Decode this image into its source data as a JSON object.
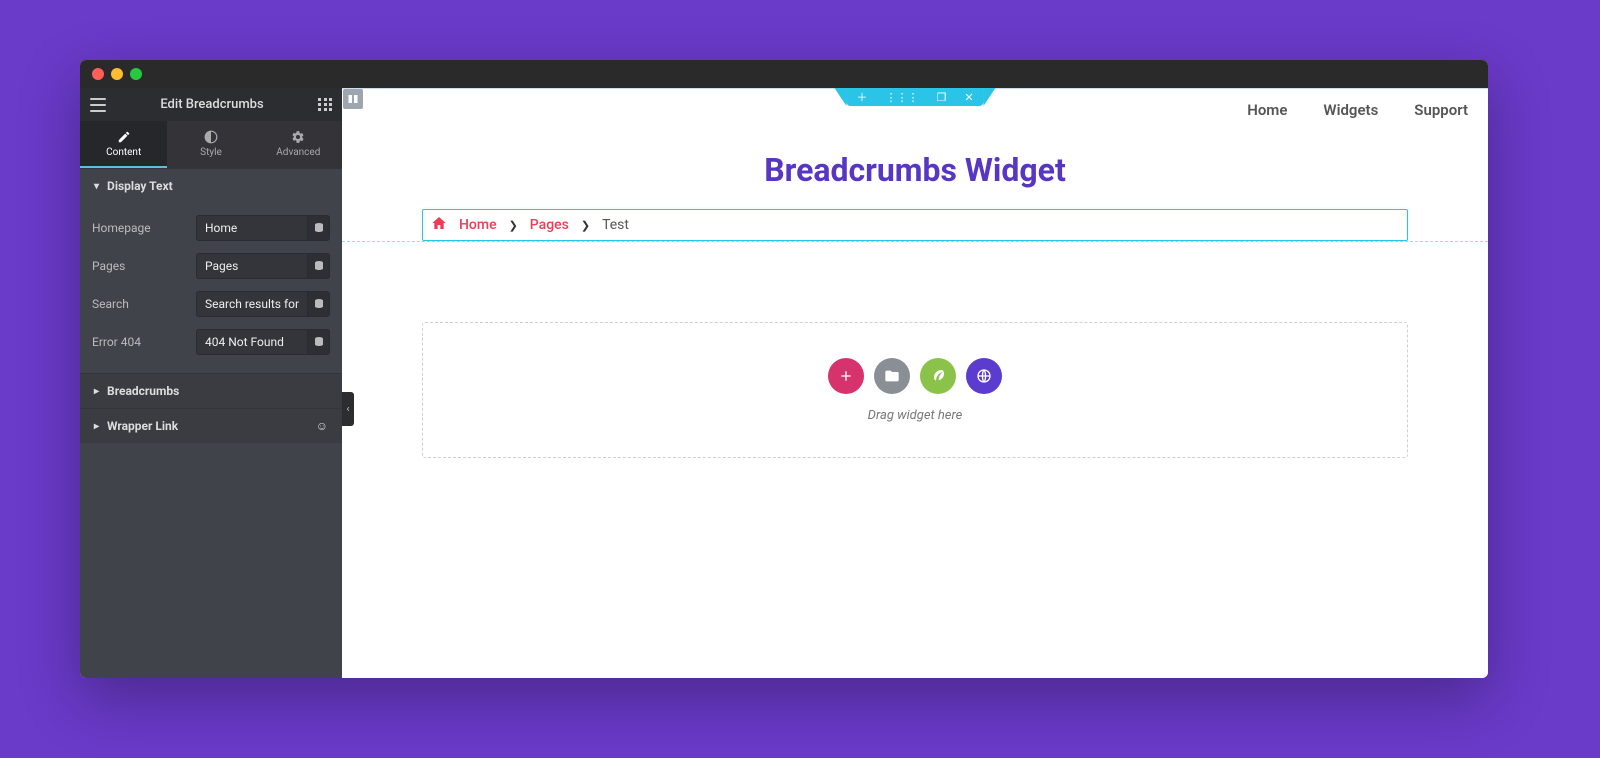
{
  "sidebar": {
    "title": "Edit Breadcrumbs",
    "tabs": {
      "content": "Content",
      "style": "Style",
      "advanced": "Advanced"
    },
    "sections": {
      "display_text": {
        "title": "Display Text",
        "fields": {
          "homepage": {
            "label": "Homepage",
            "value": "Home"
          },
          "pages": {
            "label": "Pages",
            "value": "Pages"
          },
          "search": {
            "label": "Search",
            "value": "Search results for:"
          },
          "error404": {
            "label": "Error 404",
            "value": "404 Not Found"
          }
        }
      },
      "breadcrumbs": {
        "title": "Breadcrumbs"
      },
      "wrapper_link": {
        "title": "Wrapper Link"
      }
    }
  },
  "canvas": {
    "nav": [
      "Home",
      "Widgets",
      "Support"
    ],
    "title": "Breadcrumbs Widget",
    "breadcrumb": {
      "items": [
        {
          "label": "Home",
          "link": true
        },
        {
          "label": "Pages",
          "link": true
        },
        {
          "label": "Test",
          "link": false
        }
      ]
    },
    "drop_hint": "Drag widget here"
  }
}
